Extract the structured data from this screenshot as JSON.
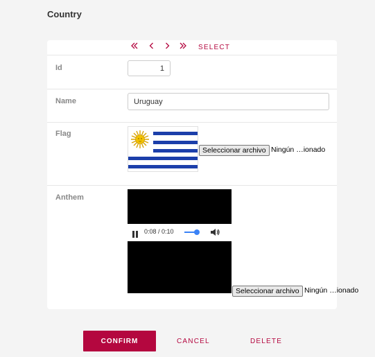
{
  "page": {
    "title": "Country"
  },
  "navigation": {
    "first_icon": "double-chevron-left-icon",
    "prev_icon": "chevron-left-icon",
    "next_icon": "chevron-right-icon",
    "last_icon": "double-chevron-right-icon",
    "select_label": "SELECT"
  },
  "fields": {
    "id": {
      "label": "Id",
      "value": "1"
    },
    "name": {
      "label": "Name",
      "value": "Uruguay"
    },
    "flag": {
      "label": "Flag",
      "file_button": "Seleccionar archivo",
      "file_status": "Ningún …ionado"
    },
    "anthem": {
      "label": "Anthem",
      "player_time": "0:08 / 0:10",
      "volume": 0.8,
      "file_button": "Seleccionar archivo",
      "file_status": "Ningún …ionado"
    }
  },
  "actions": {
    "confirm": "CONFIRM",
    "cancel": "CANCEL",
    "delete": "DELETE"
  },
  "colors": {
    "accent": "#b4073f",
    "flag_blue": "#1c3faa",
    "sun": "#f2c200"
  }
}
